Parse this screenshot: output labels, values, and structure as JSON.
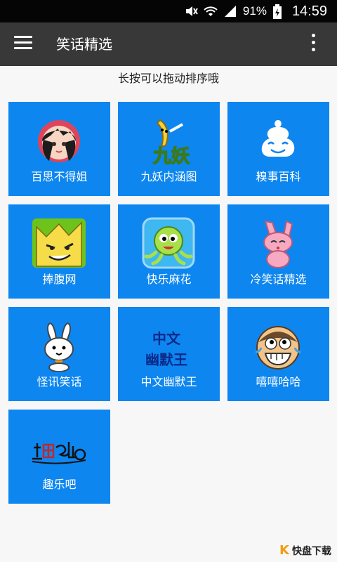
{
  "status_bar": {
    "battery": "91%",
    "time": "14:59",
    "icons": [
      "mute-icon",
      "wifi-icon",
      "signal-icon",
      "battery-icon"
    ]
  },
  "app_bar": {
    "title": "笑话精选",
    "menu_icon": "hamburger-icon",
    "overflow_icon": "overflow-menu-icon"
  },
  "hint": "长按可以拖动排序哦",
  "tiles": [
    {
      "label": "百思不得姐",
      "icon": "girl-avatar-icon"
    },
    {
      "label": "九妖内涵图",
      "icon": "banana-icon"
    },
    {
      "label": "糗事百科",
      "icon": "smiling-blob-icon"
    },
    {
      "label": "捧腹网",
      "icon": "cat-face-icon"
    },
    {
      "label": "快乐麻花",
      "icon": "octopus-icon"
    },
    {
      "label": "冷笑话精选",
      "icon": "pink-rabbit-icon"
    },
    {
      "label": "怪讯笑话",
      "icon": "white-rabbit-icon"
    },
    {
      "label": "中文幽默王",
      "icon": "humor-king-logo-icon"
    },
    {
      "label": "嘻嘻哈哈",
      "icon": "laughing-face-icon"
    },
    {
      "label": "趣乐吧",
      "icon": "qulebar-logo-icon"
    }
  ],
  "tile_color": "#0d86f0",
  "app_bar_color": "#383838",
  "watermark": {
    "mark": "K",
    "text": "快盘下载"
  }
}
